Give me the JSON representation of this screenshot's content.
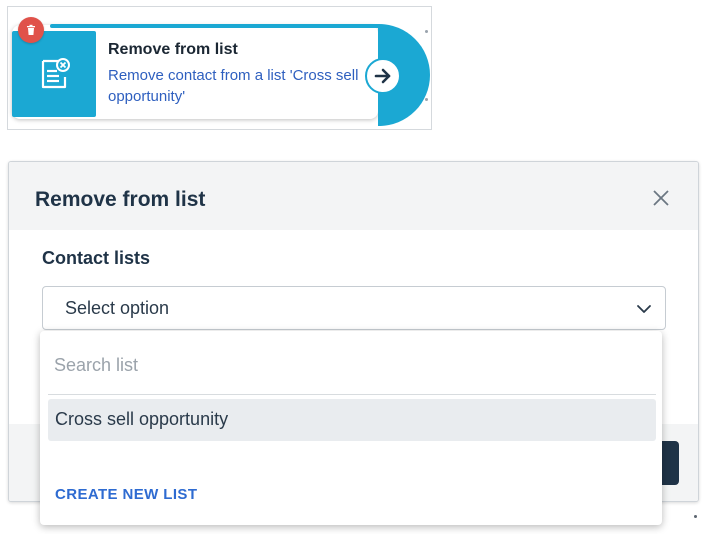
{
  "node": {
    "title": "Remove from list",
    "description": "Remove contact from a list 'Cross sell opportunity'",
    "icons": {
      "delete": "trash-icon",
      "action": "list-remove-icon",
      "next": "arrow-right-icon"
    },
    "colors": {
      "accent": "#1ba8d3",
      "delete": "#e0524a",
      "link": "#2e5fbf"
    }
  },
  "modal": {
    "title": "Remove from list",
    "close_icon": "close-icon",
    "field_label": "Contact lists",
    "select": {
      "value": "Select option",
      "chevron_icon": "chevron-down-icon"
    },
    "dropdown": {
      "search_placeholder": "Search list",
      "options": [
        "Cross sell opportunity"
      ],
      "create_label": "CREATE NEW LIST"
    },
    "colors": {
      "title": "#1f3347",
      "header_bg": "#f3f4f5",
      "link": "#2e6bd1",
      "hover": "#e9ecef"
    }
  }
}
